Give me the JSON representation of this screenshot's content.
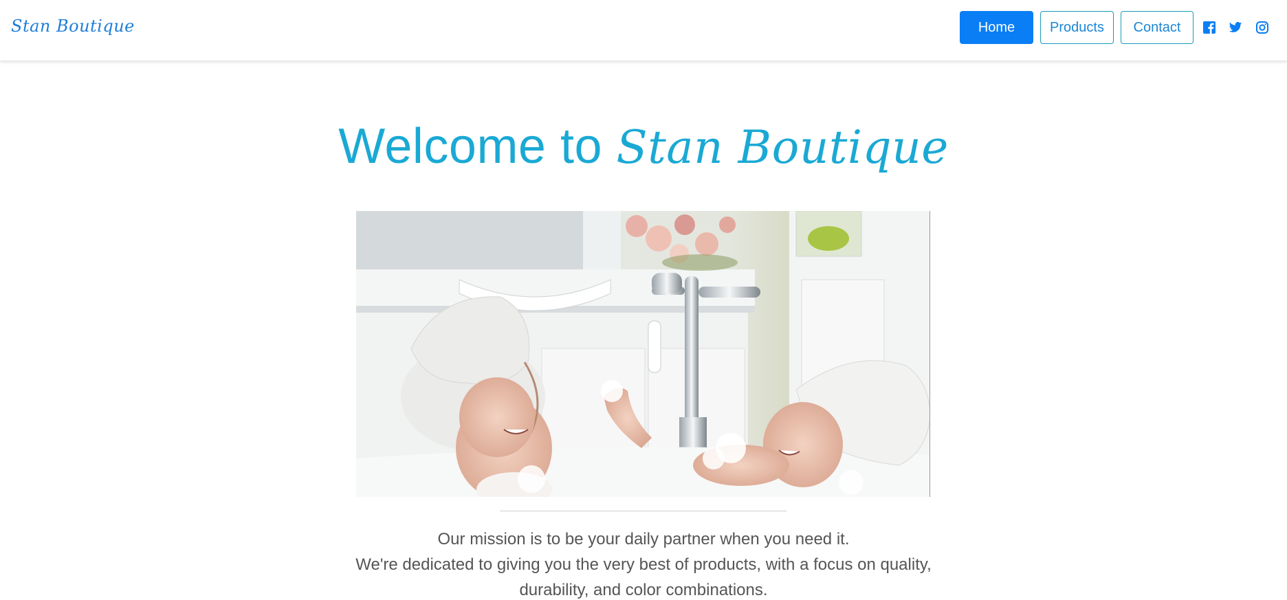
{
  "nav": {
    "brand": "Stan Boutique",
    "home_label": "Home",
    "products_label": "Products",
    "contact_label": "Contact",
    "social_icons": [
      "facebook-icon",
      "twitter-icon",
      "instagram-icon"
    ],
    "accent_color": "#0a7ef4",
    "outline_color": "#1a9bb8"
  },
  "hero": {
    "title_prefix": "Welcome to ",
    "title_brand": "Stan Boutique",
    "title_color": "#1aa9d4"
  },
  "mission": {
    "line1": "Our mission is to be your daily partner when you need it.",
    "line2": "We're dedicated to giving you the very best of products, with a focus on quality, durability, and color combinations."
  }
}
